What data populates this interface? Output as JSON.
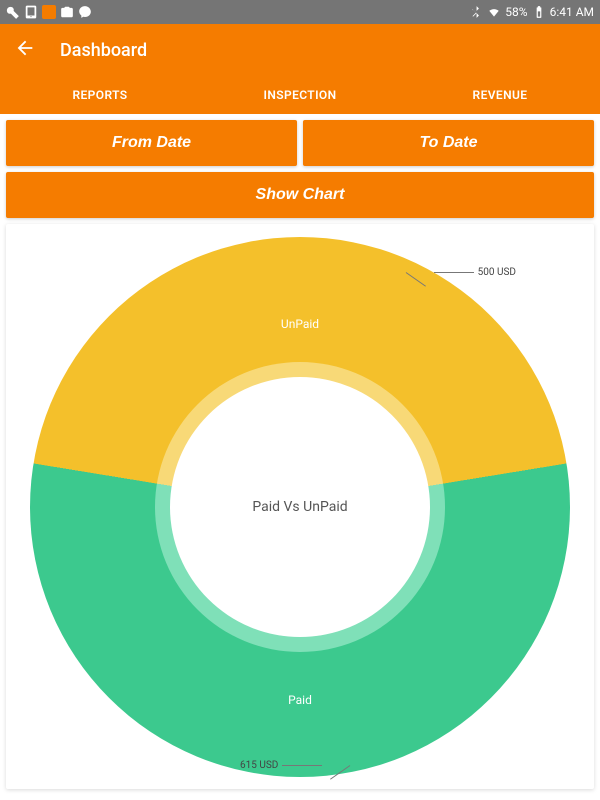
{
  "status_bar": {
    "battery_pct": "58%",
    "time": "6:41 AM"
  },
  "app_bar": {
    "title": "Dashboard"
  },
  "tabs": {
    "items": [
      {
        "label": "REPORTS"
      },
      {
        "label": "INSPECTION"
      },
      {
        "label": "REVENUE"
      }
    ]
  },
  "buttons": {
    "from_date": "From Date",
    "to_date": "To Date",
    "show_chart": "Show Chart"
  },
  "chart": {
    "center_label": "Paid Vs UnPaid",
    "segments": {
      "unpaid": {
        "label": "UnPaid",
        "callout": "500 USD"
      },
      "paid": {
        "label": "Paid",
        "callout": "615 USD"
      }
    }
  },
  "colors": {
    "accent": "#f57c00",
    "unpaid": "#f4c02b",
    "paid": "#3cc98e",
    "unpaid_ring": "#f8d977",
    "paid_ring": "#7fe0b8"
  },
  "chart_data": {
    "type": "pie",
    "title": "Paid Vs UnPaid",
    "categories": [
      "UnPaid",
      "Paid"
    ],
    "values": [
      500,
      615
    ],
    "unit": "USD",
    "series": [
      {
        "name": "UnPaid",
        "value": 500,
        "color": "#f4c02b"
      },
      {
        "name": "Paid",
        "value": 615,
        "color": "#3cc98e"
      }
    ]
  }
}
